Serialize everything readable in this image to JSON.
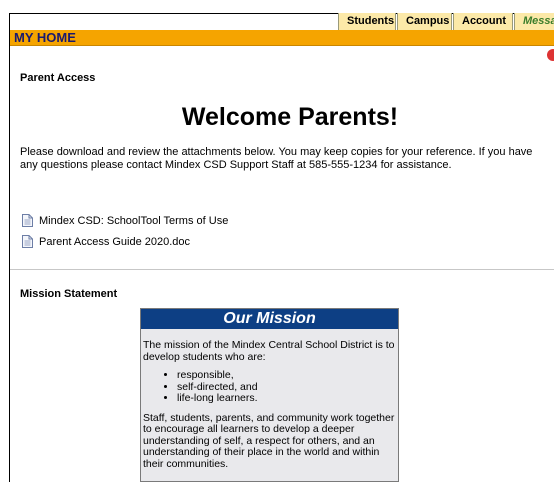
{
  "nav": {
    "tabs": [
      {
        "label": "Students"
      },
      {
        "label": "Campus"
      },
      {
        "label": "Account"
      },
      {
        "label": "Message"
      }
    ]
  },
  "header": {
    "title": "MY HOME"
  },
  "parent_access": {
    "section_title": "Parent Access",
    "welcome": "Welcome Parents!",
    "intro": "Please download and review the attachments below. You may keep copies for your reference. If you have any questions please contact Mindex CSD Support Staff at 585-555-1234 for assistance.",
    "attachments": [
      {
        "label": "Mindex CSD: SchoolTool Terms of Use",
        "icon": "document-icon"
      },
      {
        "label": "Parent Access Guide 2020.doc",
        "icon": "document-icon"
      }
    ]
  },
  "mission": {
    "section_title": "Mission Statement",
    "box_title": "Our Mission",
    "intro": "The mission of the Mindex Central School District is to develop students who are:",
    "bullets": [
      "responsible,",
      "self-directed, and",
      "life-long learners."
    ],
    "closing": "Staff, students, parents, and community work together to encourage all learners to develop a deeper understanding of self, a respect for others, and an understanding of their place in the world and within their communities."
  },
  "colors": {
    "nav_tab_bg": "#fce9a8",
    "home_bar": "#f5a400",
    "mission_header": "#0d3f84",
    "active_tab_text": "#3a7d2b"
  }
}
